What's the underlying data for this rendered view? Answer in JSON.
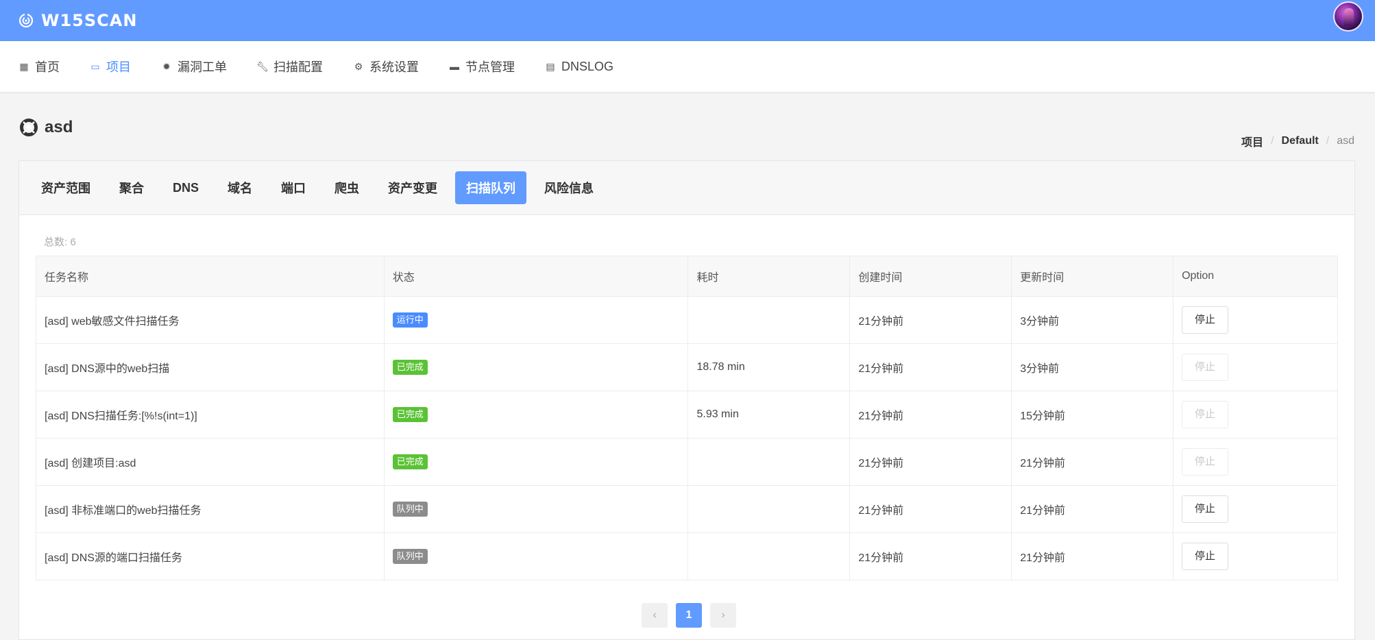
{
  "header": {
    "brand": "W15SCAN",
    "brand_color": "#619bff"
  },
  "nav": {
    "items": [
      {
        "label": "首页",
        "icon": "dashboard-icon"
      },
      {
        "label": "项目",
        "icon": "window-icon"
      },
      {
        "label": "漏洞工单",
        "icon": "bug-icon"
      },
      {
        "label": "扫描配置",
        "icon": "wrench-icon"
      },
      {
        "label": "系统设置",
        "icon": "gear-icon"
      },
      {
        "label": "节点管理",
        "icon": "monitor-icon"
      },
      {
        "label": "DNSLOG",
        "icon": "clipboard-icon"
      }
    ],
    "active": "项目",
    "active_color": "#4a8cff"
  },
  "page": {
    "title": "asd",
    "breadcrumb": [
      "项目",
      "Default",
      "asd"
    ]
  },
  "tabs": {
    "items": [
      "资产范围",
      "聚合",
      "DNS",
      "域名",
      "端口",
      "爬虫",
      "资产变更",
      "扫描队列",
      "风险信息"
    ],
    "active": "扫描队列"
  },
  "table": {
    "total": "总数: 6",
    "columns": [
      "任务名称",
      "状态",
      "耗时",
      "创建时间",
      "更新时间",
      "Option"
    ],
    "status_colors": {
      "运行中": "#4a8cff",
      "已完成": "#5bc236",
      "队列中": "#8c8c8c"
    },
    "rows": [
      {
        "name": "[asd] web敏感文件扫描任务",
        "status": "运行中",
        "duration": "",
        "created": "21分钟前",
        "updated": "3分钟前",
        "action": "停止",
        "action_enabled": true
      },
      {
        "name": "[asd] DNS源中的web扫描",
        "status": "已完成",
        "duration": "18.78 min",
        "created": "21分钟前",
        "updated": "3分钟前",
        "action": "停止",
        "action_enabled": false
      },
      {
        "name": "[asd] DNS扫描任务:[%!s(int=1)]",
        "status": "已完成",
        "duration": "5.93 min",
        "created": "21分钟前",
        "updated": "15分钟前",
        "action": "停止",
        "action_enabled": false
      },
      {
        "name": "[asd] 创建项目:asd",
        "status": "已完成",
        "duration": "",
        "created": "21分钟前",
        "updated": "21分钟前",
        "action": "停止",
        "action_enabled": false
      },
      {
        "name": "[asd] 非标准端口的web扫描任务",
        "status": "队列中",
        "duration": "",
        "created": "21分钟前",
        "updated": "21分钟前",
        "action": "停止",
        "action_enabled": true
      },
      {
        "name": "[asd] DNS源的端口扫描任务",
        "status": "队列中",
        "duration": "",
        "created": "21分钟前",
        "updated": "21分钟前",
        "action": "停止",
        "action_enabled": true
      }
    ]
  },
  "pagination": {
    "prev": "‹",
    "current": "1",
    "next": "›"
  }
}
